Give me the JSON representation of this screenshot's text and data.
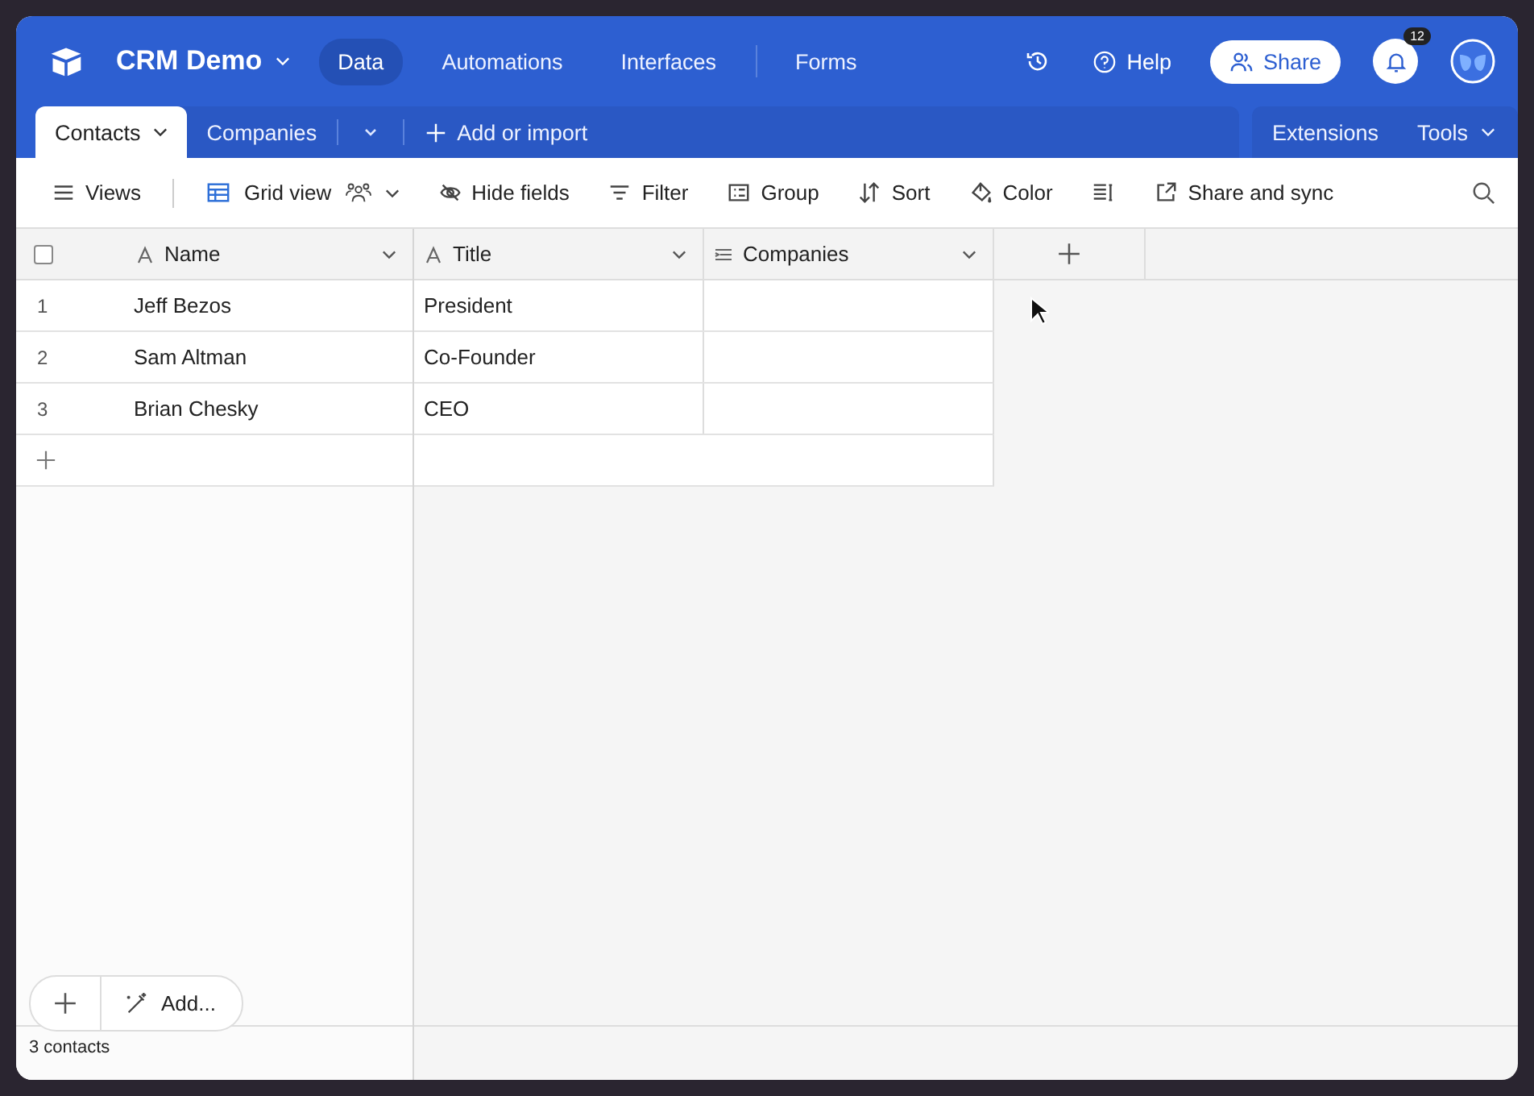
{
  "app": {
    "title": "CRM Demo",
    "help": "Help",
    "share": "Share",
    "notifications": "12"
  },
  "nav": [
    {
      "label": "Data",
      "selected": true,
      "separated": false
    },
    {
      "label": "Automations",
      "selected": false,
      "separated": false
    },
    {
      "label": "Interfaces",
      "selected": false,
      "separated": false
    },
    {
      "label": "Forms",
      "selected": false,
      "separated": true
    }
  ],
  "tables": [
    {
      "label": "Contacts",
      "selected": true
    },
    {
      "label": "Companies",
      "selected": false
    }
  ],
  "add_table": "Add or import",
  "extensions": "Extensions",
  "tools": "Tools",
  "toolbar": {
    "views": "Views",
    "view_name": "Grid view",
    "actions": [
      {
        "kind": "hide",
        "label": "Hide fields"
      },
      {
        "kind": "filter",
        "label": "Filter"
      },
      {
        "kind": "group",
        "label": "Group"
      },
      {
        "kind": "sort",
        "label": "Sort"
      },
      {
        "kind": "color",
        "label": "Color"
      },
      {
        "kind": "row-height"
      },
      {
        "kind": "share",
        "label": "Share and sync"
      }
    ]
  },
  "select_all": {
    "checked": false
  },
  "columns": [
    {
      "name": "Name",
      "kind": "text"
    },
    {
      "name": "Title",
      "kind": "text"
    },
    {
      "name": "Companies",
      "kind": "link"
    }
  ],
  "rows": [
    {
      "number": "1",
      "name": "Jeff Bezos",
      "title": "President"
    },
    {
      "number": "2",
      "name": "Sam Altman",
      "title": "Co-Founder"
    },
    {
      "number": "3",
      "name": "Brian Chesky",
      "title": "CEO"
    }
  ],
  "footer": {
    "add_label": "Add...",
    "count": "3 contacts"
  }
}
